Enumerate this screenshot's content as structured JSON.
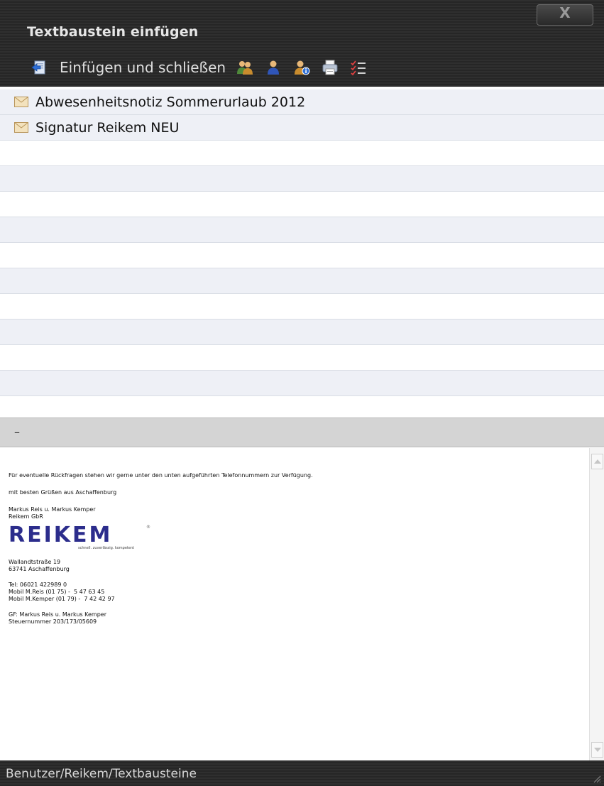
{
  "window": {
    "title": "Textbaustein einfügen",
    "close_label": "X"
  },
  "toolbar": {
    "insert_close_label": "Einfügen und schließen",
    "icons": [
      "insert-icon",
      "users-icon",
      "user-icon",
      "user-info-icon",
      "printer-icon",
      "checklist-icon"
    ]
  },
  "list": {
    "items": [
      {
        "label": "Abwesenheitsnotiz Sommerurlaub 2012",
        "icon": "envelope-icon"
      },
      {
        "label": "Signatur Reikem NEU",
        "icon": "envelope-icon"
      }
    ],
    "empty_rows": 11
  },
  "separator": {
    "label": "–"
  },
  "preview": {
    "line1": "Für eventuelle Rückfragen stehen wir gerne unter den unten aufgeführten Telefonnummern zur Verfügung.",
    "line2": "mit besten Grüßen aus Aschaffenburg",
    "line3": "Markus Reis u. Markus Kemper",
    "line4": "Reikem GbR",
    "logo_text": "REIKEM",
    "logo_tagline": "schnell. zuverlässig. kompetent",
    "logo_mark": "®",
    "addr1": "Wallandtstraße 19",
    "addr2": "63741 Aschaffenburg",
    "tel1": "Tel: 06021 422989 0",
    "tel2": "Mobil M.Reis (01 75) -  5 47 63 45",
    "tel3": "Mobil M.Kemper (01 79) -  7 42 42 97",
    "gf1": "GF: Markus Reis u. Markus Kemper",
    "gf2": "Steuernummer 203/173/05609"
  },
  "status": {
    "path": "Benutzer/Reikem/Textbausteine"
  },
  "colors": {
    "header_bg": "#2b2b2b",
    "row_alt": "#eef0f6",
    "logo": "#2c2d8c"
  }
}
